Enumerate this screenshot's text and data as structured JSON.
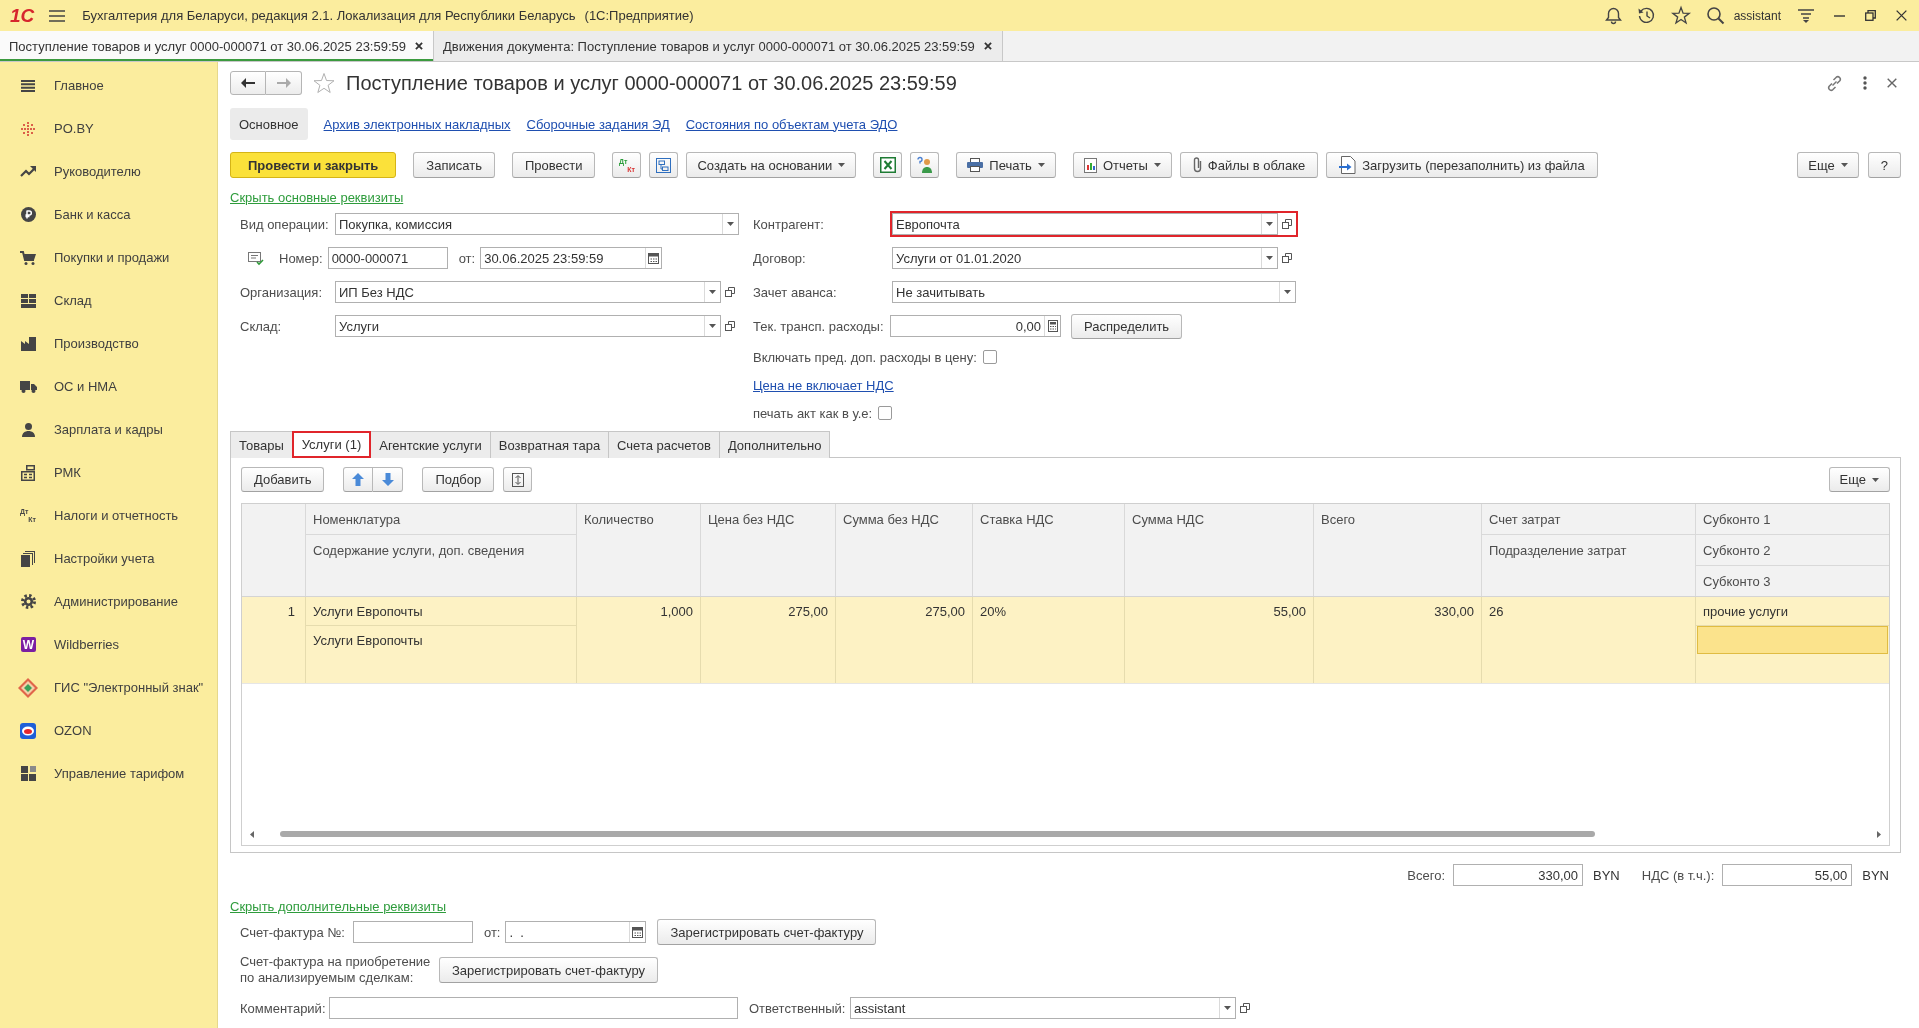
{
  "app_bar": {
    "logo": "1С",
    "title": "Бухгалтерия для Беларуси, редакция 2.1. Локализация для Республики Беларусь",
    "platform": "(1С:Предприятие)",
    "user": "assistant"
  },
  "open_tabs": [
    {
      "label": "Поступление товаров и услуг 0000-000071 от 30.06.2025 23:59:59",
      "selected": true
    },
    {
      "label": "Движения документа: Поступление товаров и услуг 0000-000071 от 30.06.2025 23:59:59",
      "selected": false
    }
  ],
  "sidebar": {
    "items": [
      {
        "label": "Главное"
      },
      {
        "label": "PO.BY"
      },
      {
        "label": "Руководителю"
      },
      {
        "label": "Банк и касса"
      },
      {
        "label": "Покупки и продажи"
      },
      {
        "label": "Склад"
      },
      {
        "label": "Производство"
      },
      {
        "label": "ОС и НМА"
      },
      {
        "label": "Зарплата и кадры"
      },
      {
        "label": "РМК"
      },
      {
        "label": "Налоги и отчетность",
        "icon_text": [
          "Дт",
          "Кт"
        ]
      },
      {
        "label": "Настройки учета"
      },
      {
        "label": "Администрирование"
      },
      {
        "label": "Wildberries",
        "icon_text": [
          "W"
        ]
      },
      {
        "label": "ГИС \"Электронный знак\""
      },
      {
        "label": "OZON"
      },
      {
        "label": "Управление тарифом"
      }
    ]
  },
  "document": {
    "back": {
      "disabled": false
    },
    "forward": {
      "disabled": true
    },
    "favorite": false,
    "title": "Поступление товаров и услуг 0000-000071 от 30.06.2025 23:59:59",
    "sections": [
      {
        "label": "Основное",
        "selected": true
      },
      {
        "label": "Архив электронных накладных",
        "selected": false
      },
      {
        "label": "Сборочные задания ЭД",
        "selected": false
      },
      {
        "label": "Состояния по объектам учета ЭДО",
        "selected": false
      }
    ],
    "command_bar": {
      "groups": [
        [
          {
            "kind": "primary",
            "label": "Провести и закрыть"
          }
        ],
        [
          {
            "kind": "plain",
            "label": "Записать"
          }
        ],
        [
          {
            "kind": "plain",
            "label": "Провести"
          }
        ],
        [
          {
            "kind": "icon",
            "icon_text": [
              "Дт",
              "Кт"
            ]
          },
          {
            "kind": "icon"
          },
          {
            "kind": "menu",
            "label": "Создать на основании"
          }
        ],
        [
          {
            "kind": "icon"
          },
          {
            "kind": "icon"
          }
        ],
        [
          {
            "kind": "menu",
            "label": "Печать"
          }
        ],
        [
          {
            "kind": "menu",
            "label": "Отчеты"
          },
          {
            "kind": "plain",
            "label": "Файлы в облаке"
          },
          {
            "kind": "plain",
            "label": "Загрузить (перезаполнить) из файла"
          }
        ]
      ],
      "right": [
        {
          "kind": "menu",
          "label": "Еще"
        },
        {
          "kind": "plain",
          "label": "?"
        }
      ]
    },
    "main_details": {
      "toggle": "Скрыть основные реквизиты",
      "left": [
        {
          "kind": "select",
          "label": "Вид операции:",
          "value": "Покупка, комиссия",
          "dropdown": true,
          "highlighted": false
        },
        {
          "kind": "number_date",
          "label": "Номер:",
          "value": "0000-000071",
          "date_label": "от:",
          "date": "30.06.2025 23:59:59",
          "highlighted": false
        },
        {
          "kind": "select",
          "label": "Организация:",
          "value": "ИП Без НДС",
          "dropdown": true,
          "open": true,
          "highlighted": false
        },
        {
          "kind": "select",
          "label": "Склад:",
          "value": "Услуги",
          "dropdown": true,
          "open": true,
          "highlighted": false
        }
      ],
      "right": [
        {
          "kind": "select",
          "label": "Контрагент:",
          "value": "Европочта",
          "dropdown": true,
          "open": true,
          "highlighted": true
        },
        {
          "kind": "select",
          "label": "Договор:",
          "value": "Услуги от 01.01.2020",
          "dropdown": true,
          "open": true,
          "highlighted": false
        },
        {
          "kind": "select",
          "label": "Зачет аванса:",
          "value": "Не зачитывать",
          "dropdown": true,
          "highlighted": false
        },
        {
          "kind": "amount",
          "label": "Тек. трансп. расходы:",
          "value": "0,00",
          "action": "Распределить",
          "highlighted": false
        },
        {
          "kind": "checkbox",
          "label": "Включать пред. доп. расходы в цену:",
          "checked": false,
          "highlighted": false
        },
        {
          "kind": "link",
          "label": "Цена не включает НДС",
          "highlighted": false
        },
        {
          "kind": "checkbox",
          "label": "печать акт как в у.е:",
          "checked": false,
          "highlighted": false
        }
      ]
    },
    "goods_tabs": [
      {
        "label": "Товары",
        "selected": false,
        "highlighted": false
      },
      {
        "label": "Услуги (1)",
        "selected": true,
        "highlighted": true
      },
      {
        "label": "Агентские услуги",
        "selected": false,
        "highlighted": false
      },
      {
        "label": "Возвратная тара",
        "selected": false,
        "highlighted": false
      },
      {
        "label": "Счета расчетов",
        "selected": false,
        "highlighted": false
      },
      {
        "label": "Дополнительно",
        "selected": false,
        "highlighted": false
      }
    ],
    "table_toolbar": {
      "left": [
        {
          "kind": "plain",
          "label": "Добавить"
        },
        {
          "kind": "arrows"
        },
        {
          "kind": "plain",
          "label": "Подбор"
        },
        {
          "kind": "icon"
        }
      ],
      "right": [
        {
          "kind": "menu",
          "label": "Еще"
        }
      ]
    },
    "grid": {
      "columns": [
        {
          "kind": "text",
          "headers": [
            "Номенклатура",
            "Содержание услуги, доп. сведения"
          ]
        },
        {
          "kind": "number",
          "headers": [
            "Количество"
          ]
        },
        {
          "kind": "number",
          "headers": [
            "Цена без НДС"
          ]
        },
        {
          "kind": "number",
          "headers": [
            "Сумма без НДС"
          ]
        },
        {
          "kind": "text",
          "headers": [
            "Ставка НДС"
          ]
        },
        {
          "kind": "number",
          "headers": [
            "Сумма НДС"
          ]
        },
        {
          "kind": "number",
          "headers": [
            "Всего"
          ]
        },
        {
          "kind": "text",
          "headers": [
            "Счет затрат",
            "Подразделение затрат"
          ]
        },
        {
          "kind": "text",
          "headers": [
            "Субконто 1",
            "Субконто 2",
            "Субконто 3"
          ]
        }
      ],
      "rows": [
        {
          "number": "1",
          "selected": true,
          "cells": [
            {
              "lines": [
                "Услуги Европочты",
                "Услуги Европочты"
              ]
            },
            {
              "lines": [
                "1,000"
              ]
            },
            {
              "lines": [
                "275,00"
              ]
            },
            {
              "lines": [
                "275,00"
              ]
            },
            {
              "lines": [
                "20%"
              ]
            },
            {
              "lines": [
                "55,00"
              ]
            },
            {
              "lines": [
                "330,00"
              ]
            },
            {
              "lines": [
                "26"
              ]
            },
            {
              "lines": [
                "прочие услуги"
              ],
              "editing": true
            }
          ]
        }
      ]
    },
    "totals": [
      {
        "label": "Всего:",
        "value": "330,00",
        "currency": "BYN"
      },
      {
        "label": "НДС (в т.ч.):",
        "value": "55,00",
        "currency": "BYN"
      }
    ],
    "extra_details": {
      "toggle": "Скрыть дополнительные реквизиты",
      "invoice": {
        "label": "Счет-фактура №:",
        "date_label": "от:",
        "date": ".  .",
        "button": "Зарегистрировать счет-фактуру"
      },
      "analyzed_invoice": {
        "label_lines": [
          "Счет-фактура на приобретение",
          "по анализируемым сделкам:"
        ],
        "button": "Зарегистрировать счет-фактуру"
      },
      "comment": {
        "label": "Комментарий:"
      },
      "responsible": {
        "label": "Ответственный:",
        "value": "assistant",
        "dropdown": true,
        "open": true
      }
    }
  }
}
